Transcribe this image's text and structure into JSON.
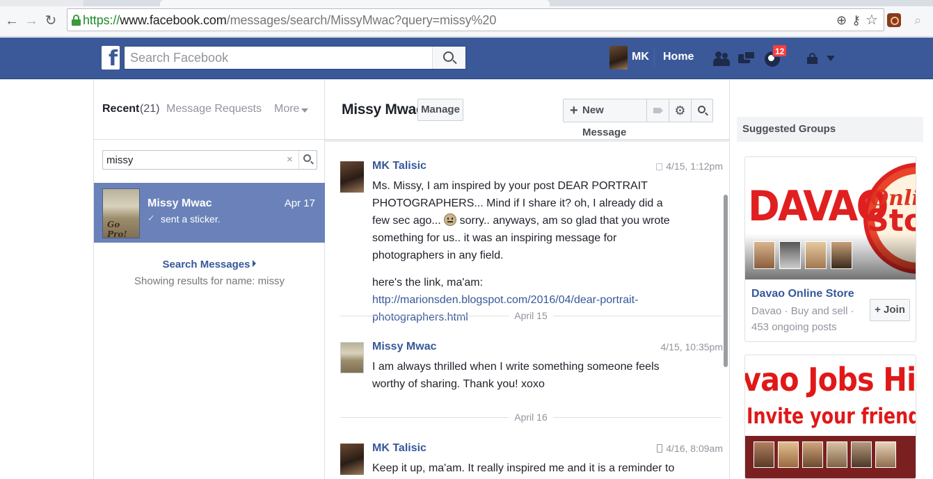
{
  "browser": {
    "url_protocol": "https://",
    "url_host": "www.facebook.com",
    "url_path": "/messages/search/MissyMwac?query=missy%20"
  },
  "fb": {
    "search_placeholder": "Search Facebook",
    "user_name": "MK",
    "home_label": "Home",
    "notifications_count": "12"
  },
  "left": {
    "recent_label": "Recent",
    "recent_count": "(21)",
    "requests_label": "Message Requests",
    "more_label": "More",
    "filter_value": "missy",
    "clear_glyph": "×",
    "thread": {
      "name": "Missy Mwac",
      "date": "Apr 17",
      "snippet": "sent a sticker.",
      "avatar_text": "Go Pro!"
    },
    "search_messages": "Search Messages",
    "showing": "Showing results for name: missy"
  },
  "conversation": {
    "title": "Missy Mwac",
    "manage_label": "Manage",
    "new_message_label": "New Message",
    "messages": [
      {
        "sender": "MK Talisic",
        "time": "4/15, 1:12pm",
        "p1_before": "Ms. Missy, I am inspired by your post DEAR PORTRAIT PHOTOGRAPHERS... Mind if I share it? oh, I already did a few sec ago... ",
        "p1_after": " sorry.. anyways, am so glad that you wrote something for us.. it was an inspiring message for photographers in any field.",
        "p2_before": "here's the link, ma'am: ",
        "link": "http://marionsden.blogspot.com/2016/04/dear-portrait-photographers.html"
      },
      {
        "sender": "Missy Mwac",
        "time": "4/15, 10:35pm",
        "text": "I am always thrilled when I write something someone feels worthy of sharing. Thank you! xoxo"
      },
      {
        "sender": "MK Talisic",
        "time": "4/16, 8:09am",
        "text": "Keep it up, ma'am. It really inspired me and it is a reminder to me that"
      }
    ],
    "dividers": [
      "April 15",
      "April 16"
    ]
  },
  "right": {
    "suggested_label": "Suggested Groups",
    "groups": [
      {
        "name": "Davao Online Store",
        "meta": "Davao · Buy and sell · 453 ongoing posts",
        "join_label": "Join",
        "cover_text_main": "DAVAO",
        "cover_text_script": "Online",
        "cover_text_store": "Sto"
      },
      {
        "cover_text_main": "vao Jobs Hir",
        "cover_text_sub": "Invite your friends"
      }
    ]
  },
  "colors": {
    "fb_blue": "#3b5998",
    "link_blue": "#365899",
    "selected_thread": "#6a82b9",
    "badge_red": "#fa3e3e"
  }
}
